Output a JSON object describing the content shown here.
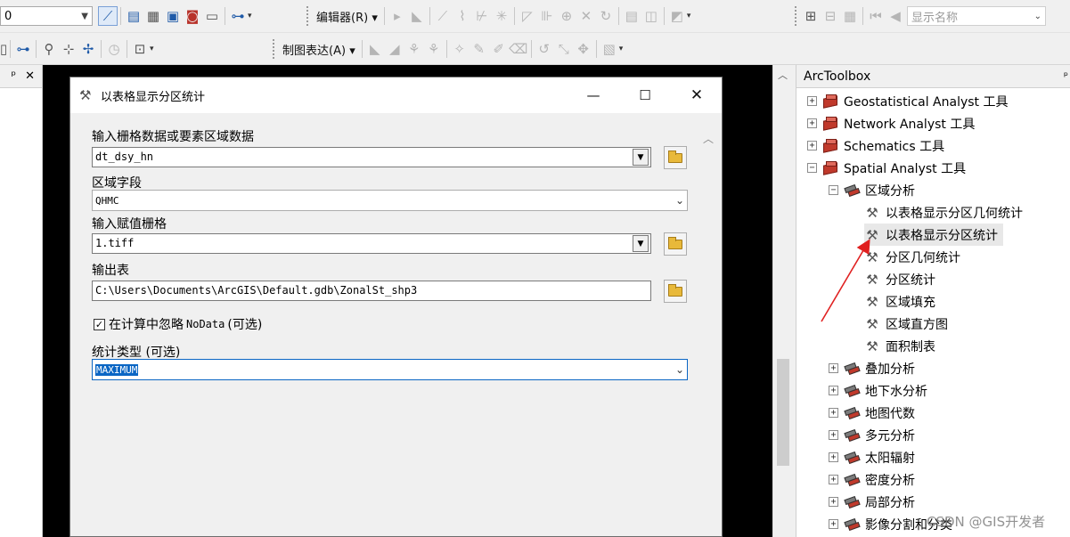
{
  "toolbar1": {
    "scale_combo_value": "0",
    "editor_menu": "编辑器(R)",
    "editor_menu_arrow": "▾",
    "label_field_combo": "显示名称"
  },
  "toolbar2": {
    "representation_menu": "制图表达(A)",
    "representation_menu_arrow": "▾"
  },
  "left_panel": {
    "pin_glyph": "ᵖ",
    "close_glyph": "✕"
  },
  "dialog": {
    "title": "以表格显示分区统计",
    "fields": {
      "input_raster_label": "输入栅格数据或要素区域数据",
      "input_raster_value": "dt_dsy_hn",
      "zone_field_label": "区域字段",
      "zone_field_value": "QHMC",
      "value_raster_label": "输入赋值栅格",
      "value_raster_value": "1.tiff",
      "output_table_label": "输出表",
      "output_table_value": "C:\\Users\\Documents\\ArcGIS\\Default.gdb\\ZonalSt_shp3",
      "ignore_nodata_pre": "在计算中忽略",
      "ignore_nodata_code": "NoData",
      "ignore_nodata_post": "(可选)",
      "ignore_nodata_checked": true,
      "stat_type_label": "统计类型 (可选)",
      "stat_type_value": "MAXIMUM"
    }
  },
  "toolbox": {
    "title": "ArcToolbox",
    "pin_glyph": "ᵖ",
    "items": [
      {
        "label": "Geostatistical Analyst 工具",
        "expander": "+",
        "kind": "toolbox"
      },
      {
        "label": "Network Analyst 工具",
        "expander": "+",
        "kind": "toolbox"
      },
      {
        "label": "Schematics 工具",
        "expander": "+",
        "kind": "toolbox"
      },
      {
        "label": "Spatial Analyst 工具",
        "expander": "−",
        "kind": "toolbox"
      },
      {
        "label": "区域分析",
        "expander": "−",
        "kind": "toolset"
      },
      {
        "label": "以表格显示分区几何统计",
        "kind": "tool"
      },
      {
        "label": "以表格显示分区统计",
        "kind": "tool",
        "selected": true
      },
      {
        "label": "分区几何统计",
        "kind": "tool"
      },
      {
        "label": "分区统计",
        "kind": "tool"
      },
      {
        "label": "区域填充",
        "kind": "tool"
      },
      {
        "label": "区域直方图",
        "kind": "tool"
      },
      {
        "label": "面积制表",
        "kind": "tool"
      },
      {
        "label": "叠加分析",
        "expander": "+",
        "kind": "toolset"
      },
      {
        "label": "地下水分析",
        "expander": "+",
        "kind": "toolset"
      },
      {
        "label": "地图代数",
        "expander": "+",
        "kind": "toolset"
      },
      {
        "label": "多元分析",
        "expander": "+",
        "kind": "toolset"
      },
      {
        "label": "太阳辐射",
        "expander": "+",
        "kind": "toolset"
      },
      {
        "label": "密度分析",
        "expander": "+",
        "kind": "toolset"
      },
      {
        "label": "局部分析",
        "expander": "+",
        "kind": "toolset"
      },
      {
        "label": "影像分割和分类",
        "expander": "+",
        "kind": "toolset"
      }
    ]
  },
  "annotation": {
    "arrow_color": "#e02020"
  },
  "watermark": "CSDN @GIS开发者",
  "colors": {
    "accent": "#0b66c4",
    "toolbox_red": "#c0392b"
  }
}
